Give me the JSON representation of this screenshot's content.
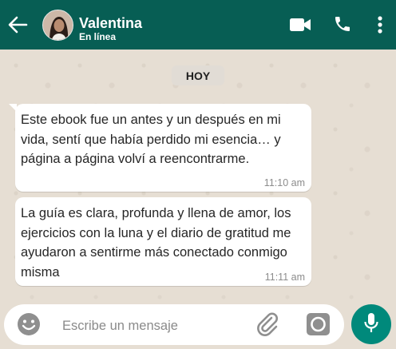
{
  "header": {
    "contact_name": "Valentina",
    "contact_status": "En línea",
    "back_icon": "arrow-left-icon",
    "video_icon": "video-call-icon",
    "phone_icon": "phone-icon",
    "more_icon": "more-vertical-icon",
    "color": "#075e54"
  },
  "chat": {
    "day_badge": "HOY",
    "messages": [
      {
        "text": "Este ebook fue un antes y un después en mi vida, sentí que había perdido mi esencia… y página a página volví a reencontrarme.",
        "time": "11:10 am"
      },
      {
        "text": "La guía es clara, profunda y llena de amor, los ejercicios con la luna y el diario de gratitud me ayudaron a sentirme más conectado conmigo misma",
        "time": "11:11 am"
      }
    ]
  },
  "composer": {
    "placeholder": "Escribe un mensaje",
    "emoji_icon": "emoji-icon",
    "attach_icon": "paperclip-icon",
    "camera_icon": "camera-icon",
    "mic_icon": "microphone-icon",
    "accent": "#00897b"
  }
}
